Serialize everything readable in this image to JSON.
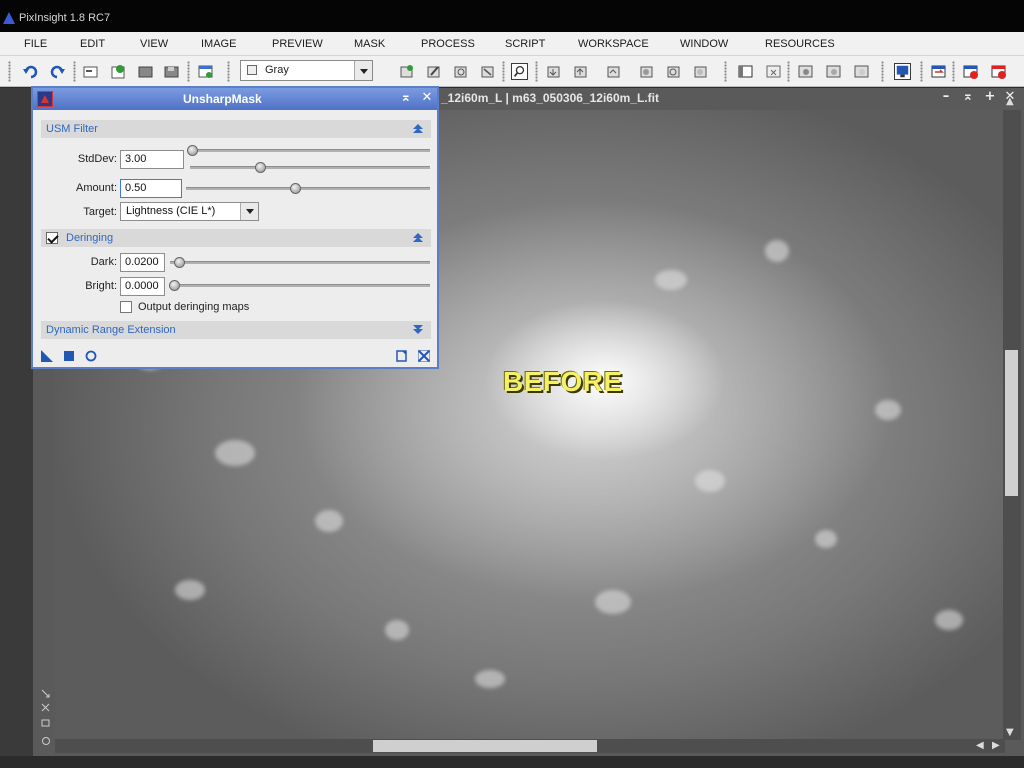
{
  "app": {
    "title": "PixInsight 1.8 RC7"
  },
  "menu": [
    "FILE",
    "EDIT",
    "VIEW",
    "IMAGE",
    "PREVIEW",
    "MASK",
    "PROCESS",
    "SCRIPT",
    "WORKSPACE",
    "WINDOW",
    "RESOURCES"
  ],
  "toolbar": {
    "color_space_combo": "Gray"
  },
  "image_window": {
    "title": "_12i60m_L | m63_050306_12i60m_L.fit",
    "overlay_label": "BEFORE"
  },
  "usm_dialog": {
    "title": "UnsharpMask",
    "sections": {
      "usm_filter": "USM Filter",
      "deringing": "Deringing",
      "dynamic_range": "Dynamic Range Extension"
    },
    "stddev": {
      "label": "StdDev:",
      "value": "3.00"
    },
    "amount": {
      "label": "Amount:",
      "value": "0.50"
    },
    "target": {
      "label": "Target:",
      "value": "Lightness (CIE L*)"
    },
    "dark": {
      "label": "Dark:",
      "value": "0.0200"
    },
    "bright": {
      "label": "Bright:",
      "value": "0.0000"
    },
    "output_maps": {
      "label": "Output deringing maps",
      "checked": false
    },
    "deringing_enabled": true
  },
  "colors": {
    "dialog_header": "#4f72c6",
    "section_text": "#2f67c2",
    "before_text": "#f5f065"
  }
}
